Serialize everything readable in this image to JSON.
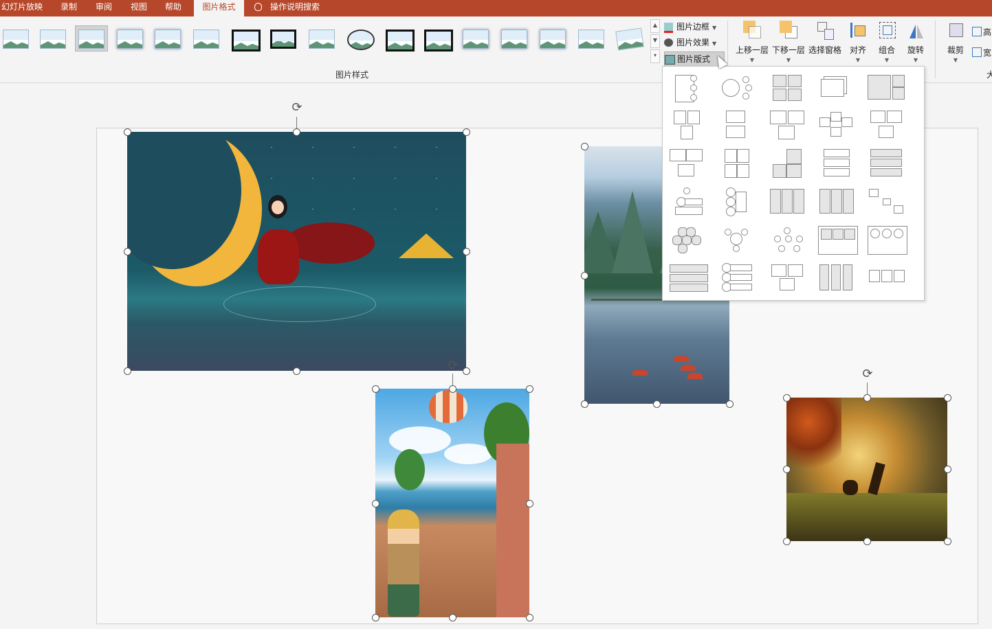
{
  "tabs": [
    {
      "label": "幻灯片放映"
    },
    {
      "label": "录制"
    },
    {
      "label": "审阅"
    },
    {
      "label": "视图"
    },
    {
      "label": "帮助"
    },
    {
      "label": "图片格式",
      "active": true
    }
  ],
  "search": {
    "label": "操作说明搜索",
    "icon": "lightbulb-icon"
  },
  "picture_styles": {
    "group_label": "图片样式",
    "thumbnail_count": 17,
    "selected_index": 2
  },
  "picture_commands": {
    "border": "图片边框",
    "effects": "图片效果",
    "layout": "图片版式"
  },
  "arrange": {
    "bring_forward": "上移一层",
    "send_backward": "下移一层",
    "selection_pane": "选择窗格",
    "align": "对齐",
    "group": "组合",
    "rotate": "旋转",
    "crop": "裁剪"
  },
  "size": {
    "height_label": "高",
    "width_label": "宽",
    "group_label_partial": "大"
  },
  "layout_gallery": {
    "rows": 6,
    "columns": 5
  },
  "colors": {
    "tab_bar": "#b7472a",
    "ribbon": "#f4f4f4",
    "accent_text": "#b7472a"
  }
}
